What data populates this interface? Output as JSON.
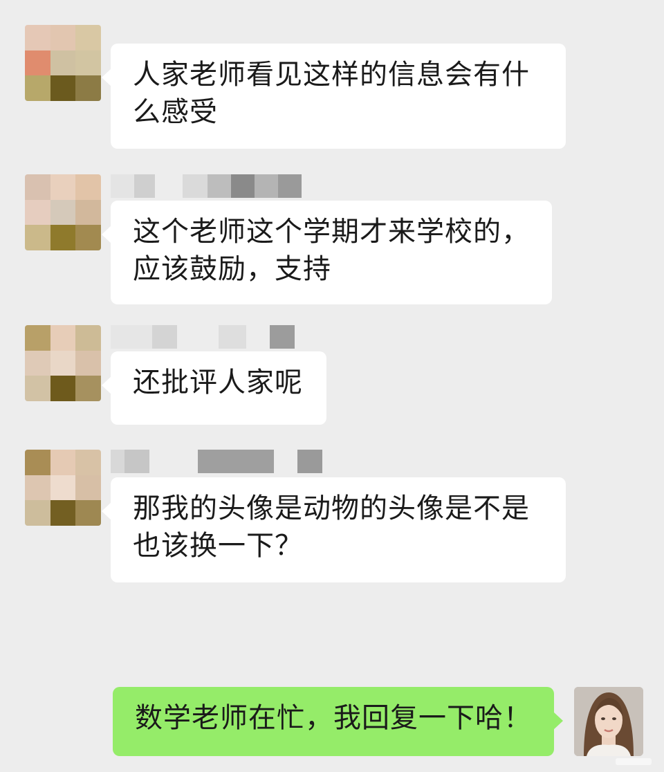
{
  "messages": [
    {
      "direction": "incoming",
      "text": "人家老师看见这样的信息会有什么感受"
    },
    {
      "direction": "incoming",
      "text": "这个老师这个学期才来学校的，应该鼓励，支持"
    },
    {
      "direction": "incoming",
      "text": "还批评人家呢"
    },
    {
      "direction": "incoming",
      "text": "那我的头像是动物的头像是不是也该换一下？"
    },
    {
      "direction": "outgoing",
      "text": "数学老师在忙，我回复一下哈！"
    }
  ],
  "colors": {
    "background": "#ededed",
    "incoming_bubble": "#ffffff",
    "outgoing_bubble": "#95ec69",
    "text": "#1a1a1a"
  },
  "icons": {
    "sender_avatars": "pixelated-avatar-icon",
    "my_avatar": "woman-portrait-avatar-icon"
  }
}
